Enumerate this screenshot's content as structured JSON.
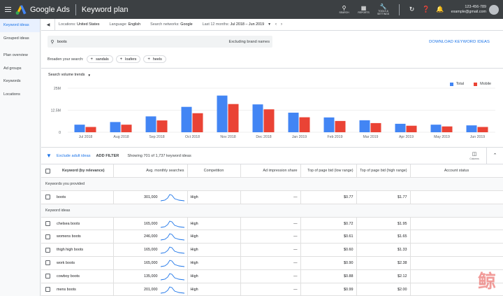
{
  "app": {
    "brand": "Google Ads",
    "page_title": "Keyword plan",
    "tools": [
      {
        "icon": "search-icon",
        "label": "SEARCH"
      },
      {
        "icon": "reports-icon",
        "label": "REPORTS"
      },
      {
        "icon": "wrench-icon",
        "label": "TOOLS & SETTINGS"
      }
    ],
    "account": {
      "id": "123-456-789",
      "email": "example@gmail.com"
    }
  },
  "sidebar": {
    "items": [
      {
        "label": "Keyword ideas",
        "active": true
      },
      {
        "label": "Grouped ideas",
        "active": false
      },
      {
        "label": "Plan overview",
        "active": false
      },
      {
        "label": "Ad groups",
        "active": false
      },
      {
        "label": "Keywords",
        "active": false
      },
      {
        "label": "Locations",
        "active": false
      }
    ]
  },
  "filters": {
    "locations_label": "Locations:",
    "locations_value": "United States",
    "language_label": "Language:",
    "language_value": "English",
    "networks_label": "Search networks:",
    "networks_value": "Google",
    "period_label": "Last 12 months:",
    "period_value": "Jul 2018 – Jun 2019"
  },
  "search": {
    "value": "boots",
    "excluding": "Excluding brand names",
    "download_label": "DOWNLOAD KEYWORD IDEAS",
    "broaden_label": "Broaden your search:",
    "chips": [
      "sandals",
      "loafers",
      "heels"
    ]
  },
  "chart_data": {
    "type": "bar",
    "dropdown_label": "Search volume trends",
    "categories": [
      "Jul 2018",
      "Aug 2018",
      "Sep 2018",
      "Oct 2018",
      "Nov 2018",
      "Dec 2018",
      "Jan 2019",
      "Feb 2019",
      "Mar 2019",
      "Apr 2019",
      "May 2019",
      "Jun 2019"
    ],
    "series": [
      {
        "name": "Total",
        "color": "#4285f4",
        "values": [
          4.3,
          5.8,
          9.0,
          14.4,
          20.8,
          15.8,
          11.1,
          8.4,
          6.8,
          4.8,
          4.3,
          3.9
        ]
      },
      {
        "name": "Mobile",
        "color": "#ea4335",
        "values": [
          3.0,
          4.3,
          6.7,
          10.8,
          16.0,
          13.0,
          8.5,
          6.4,
          5.2,
          3.7,
          3.3,
          3.0
        ]
      }
    ],
    "yticks": [
      "0",
      "12.5M",
      "25M"
    ],
    "ylim": [
      0,
      25
    ],
    "grid": true,
    "legend_position": "top-right"
  },
  "table": {
    "exclude_adult": "Exclude adult ideas",
    "add_filter": "ADD FILTER",
    "showing": "Showing 701 of 1,737 keyword ideas",
    "columns_label": "Columns",
    "headers": [
      "Keyword (by relevance)",
      "Avg. monthly searches",
      "Competition",
      "Ad impression share",
      "Top of page bid (low range)",
      "Top of page bid (high range)",
      "Account status"
    ],
    "group_provided": "Keywords you provided",
    "group_ideas": "Keyword ideas",
    "provided": [
      {
        "keyword": "boots",
        "avg": "301,000",
        "competition": "High",
        "share": "—",
        "low": "$0.77",
        "high": "$1.77",
        "status": ""
      }
    ],
    "ideas": [
      {
        "keyword": "chelsea boots",
        "avg": "165,000",
        "competition": "High",
        "share": "—",
        "low": "$0.72",
        "high": "$1.95",
        "status": ""
      },
      {
        "keyword": "womens boots",
        "avg": "246,000",
        "competition": "High",
        "share": "—",
        "low": "$0.61",
        "high": "$1.65",
        "status": ""
      },
      {
        "keyword": "thigh high boots",
        "avg": "165,000",
        "competition": "High",
        "share": "—",
        "low": "$0.60",
        "high": "$1.33",
        "status": ""
      },
      {
        "keyword": "work boots",
        "avg": "165,000",
        "competition": "High",
        "share": "—",
        "low": "$0.90",
        "high": "$2.38",
        "status": ""
      },
      {
        "keyword": "cowboy boots",
        "avg": "135,000",
        "competition": "High",
        "share": "—",
        "low": "$0.88",
        "high": "$2.12",
        "status": ""
      },
      {
        "keyword": "mens boots",
        "avg": "201,000",
        "competition": "High",
        "share": "—",
        "low": "$0.99",
        "high": "$2.00",
        "status": ""
      }
    ]
  },
  "watermark": "鲸"
}
